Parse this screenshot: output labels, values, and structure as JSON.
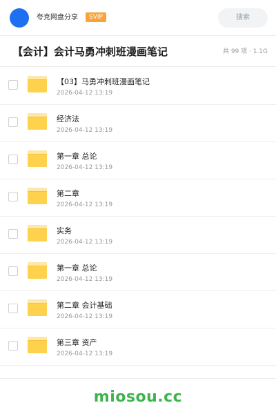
{
  "header": {
    "brand_name": "夸克网盘分享",
    "badge": "SVIP",
    "search_placeholder": "搜索"
  },
  "folder": {
    "title": "【会计】会计马勇冲刺班漫画笔记",
    "meta": "共 99 项 · 1.1G"
  },
  "items": [
    {
      "name": "【03】马勇冲刺班漫画笔记",
      "date": "2026-04-12 13:19"
    },
    {
      "name": "经济法",
      "date": "2026-04-12 13:19"
    },
    {
      "name": "第一章  总论",
      "date": "2026-04-12 13:19"
    },
    {
      "name": "第二章",
      "date": "2026-04-12 13:19"
    },
    {
      "name": "实务",
      "date": "2026-04-12 13:19"
    },
    {
      "name": "第一章  总论",
      "date": "2026-04-12 13:19"
    },
    {
      "name": "第二章 会计基础",
      "date": "2026-04-12 13:19"
    },
    {
      "name": "第三章  资产",
      "date": "2026-04-12 13:19"
    }
  ],
  "footer": {
    "watermark": "miosou.cc"
  },
  "colors": {
    "avatar": "#1e6ff2",
    "badge": "#f7a43a",
    "folder": "#ffd24d",
    "watermark": "#3cb44b"
  }
}
